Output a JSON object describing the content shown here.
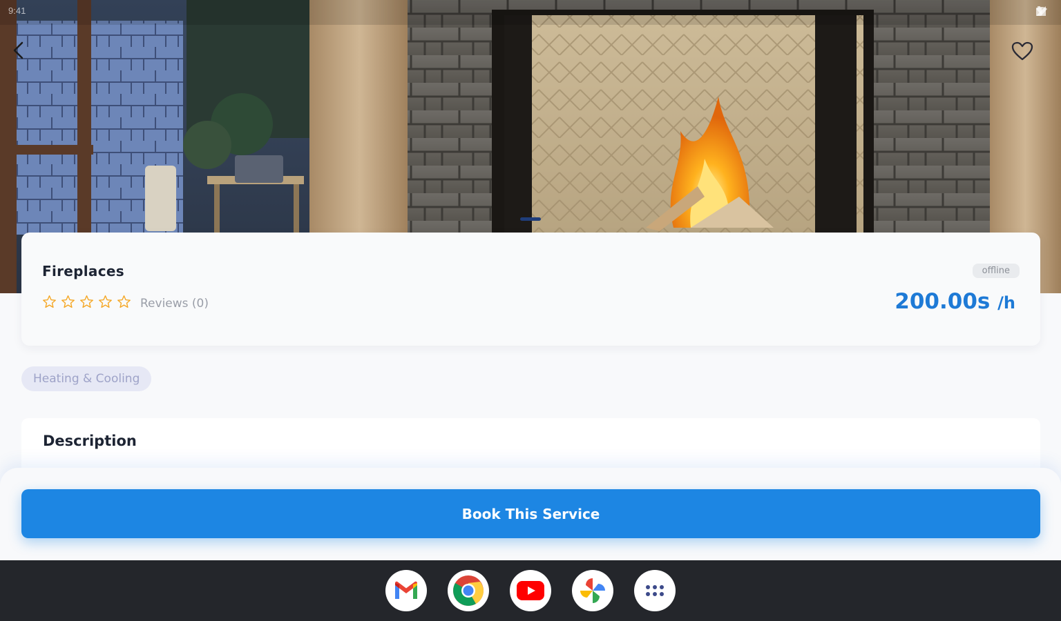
{
  "status_bar": {
    "time": "9:41"
  },
  "service": {
    "title": "Fireplaces",
    "rating": 0,
    "rating_max": 5,
    "reviews_label": "Reviews (0)",
    "status": "offline",
    "price": "200.00s",
    "price_unit": "/h",
    "category": "Heating & Cooling"
  },
  "description": {
    "title": "Description"
  },
  "booking": {
    "button_label": "Book This Service"
  },
  "colors": {
    "accent": "#1d86e3",
    "star": "#f5a623",
    "price": "#1e7ad6"
  },
  "dock": {
    "apps": [
      "gmail-icon",
      "chrome-icon",
      "youtube-icon",
      "photos-icon",
      "app-drawer-icon"
    ]
  }
}
